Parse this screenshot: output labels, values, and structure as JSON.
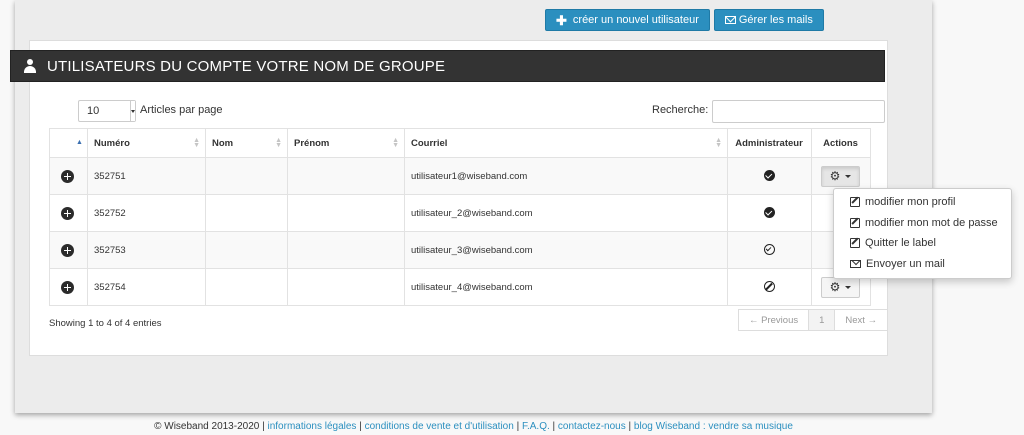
{
  "toolbar": {
    "create_user_label": "créer un nouvel utilisateur",
    "manage_mails_label": "Gérer les mails"
  },
  "panel": {
    "title": "UTILISATEURS DU COMPTE VOTRE NOM DE GROUPE"
  },
  "table_controls": {
    "page_length": "10",
    "page_length_label": "Articles par page",
    "search_label": "Recherche:",
    "search_value": ""
  },
  "table": {
    "columns": [
      "Numéro",
      "Nom",
      "Prénom",
      "Courriel",
      "Administrateur",
      "Actions"
    ],
    "rows": [
      {
        "numero": "352751",
        "nom": "",
        "prenom": "",
        "courriel": "utilisateur1@wiseband.com",
        "admin": "check-circle-icon"
      },
      {
        "numero": "352752",
        "nom": "",
        "prenom": "",
        "courriel": "utilisateur_2@wiseband.com",
        "admin": "check-circle-icon"
      },
      {
        "numero": "352753",
        "nom": "",
        "prenom": "",
        "courriel": "utilisateur_3@wiseband.com",
        "admin": "check-outline-icon"
      },
      {
        "numero": "352754",
        "nom": "",
        "prenom": "",
        "courriel": "utilisateur_4@wiseband.com",
        "admin": "ban-icon"
      }
    ]
  },
  "actions_menu": {
    "items": [
      "modifier mon profil",
      "modifier mon mot de passe",
      "Quitter le label",
      "Envoyer un mail"
    ]
  },
  "pagination": {
    "info": "Showing 1 to 4 of 4 entries",
    "previous": "← Previous",
    "page": "1",
    "next": "Next →"
  },
  "footer": {
    "copyright": "© Wiseband 2013-2020",
    "sep": " | ",
    "links": [
      "informations légales",
      "conditions de vente et d'utilisation",
      "F.A.Q.",
      "contactez-nous",
      "blog Wiseband : vendre sa musique"
    ]
  },
  "colors": {
    "primary_button": "#2b8fbf",
    "panel_header": "#333333",
    "link": "#2b8fbf"
  }
}
